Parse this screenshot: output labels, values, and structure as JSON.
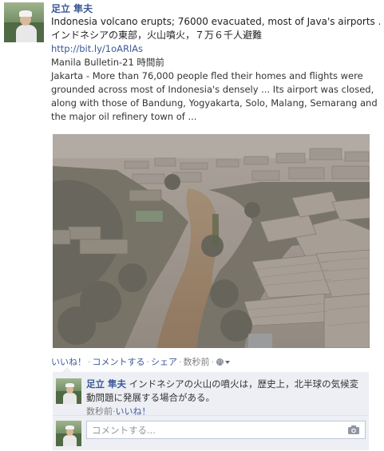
{
  "post": {
    "author": "足立 隼夫",
    "title": "Indonesia volcano erupts; 76000 evacuated, most of Java's airports ...",
    "title_ja": "インドネシアの東部，火山噴火，７万６千人避難",
    "link": "http://bit.ly/1oARlAs",
    "source": "Manila Bulletin-21 時間前",
    "summary": "Jakarta - More than 76,000 people fled their homes and flights were grounded across most of Indonesia's densely ... Its airport was closed, along with those of Bandung, Yogyakarta, Solo, Malang, Semarang and the major oil refinery town of ..."
  },
  "actions": {
    "like": "いいね！",
    "comment": "コメントする",
    "share": "シェア",
    "timestamp": "数秒前",
    "separator": "·",
    "privacy_icon": "globe-icon"
  },
  "comment": {
    "author": "足立 隼夫",
    "text_line1": "インドネシアの火山の噴火は，歴史上，北半球の気候変",
    "text_line2": "動問題に発展する場合がある。",
    "timestamp": "数秒前",
    "like": "いいね！"
  },
  "composer": {
    "placeholder": "コメントする...",
    "camera_icon": "camera-icon"
  },
  "colors": {
    "link": "#3b5998",
    "ufi_background": "#edeff4",
    "muted": "#7f7f7f"
  }
}
